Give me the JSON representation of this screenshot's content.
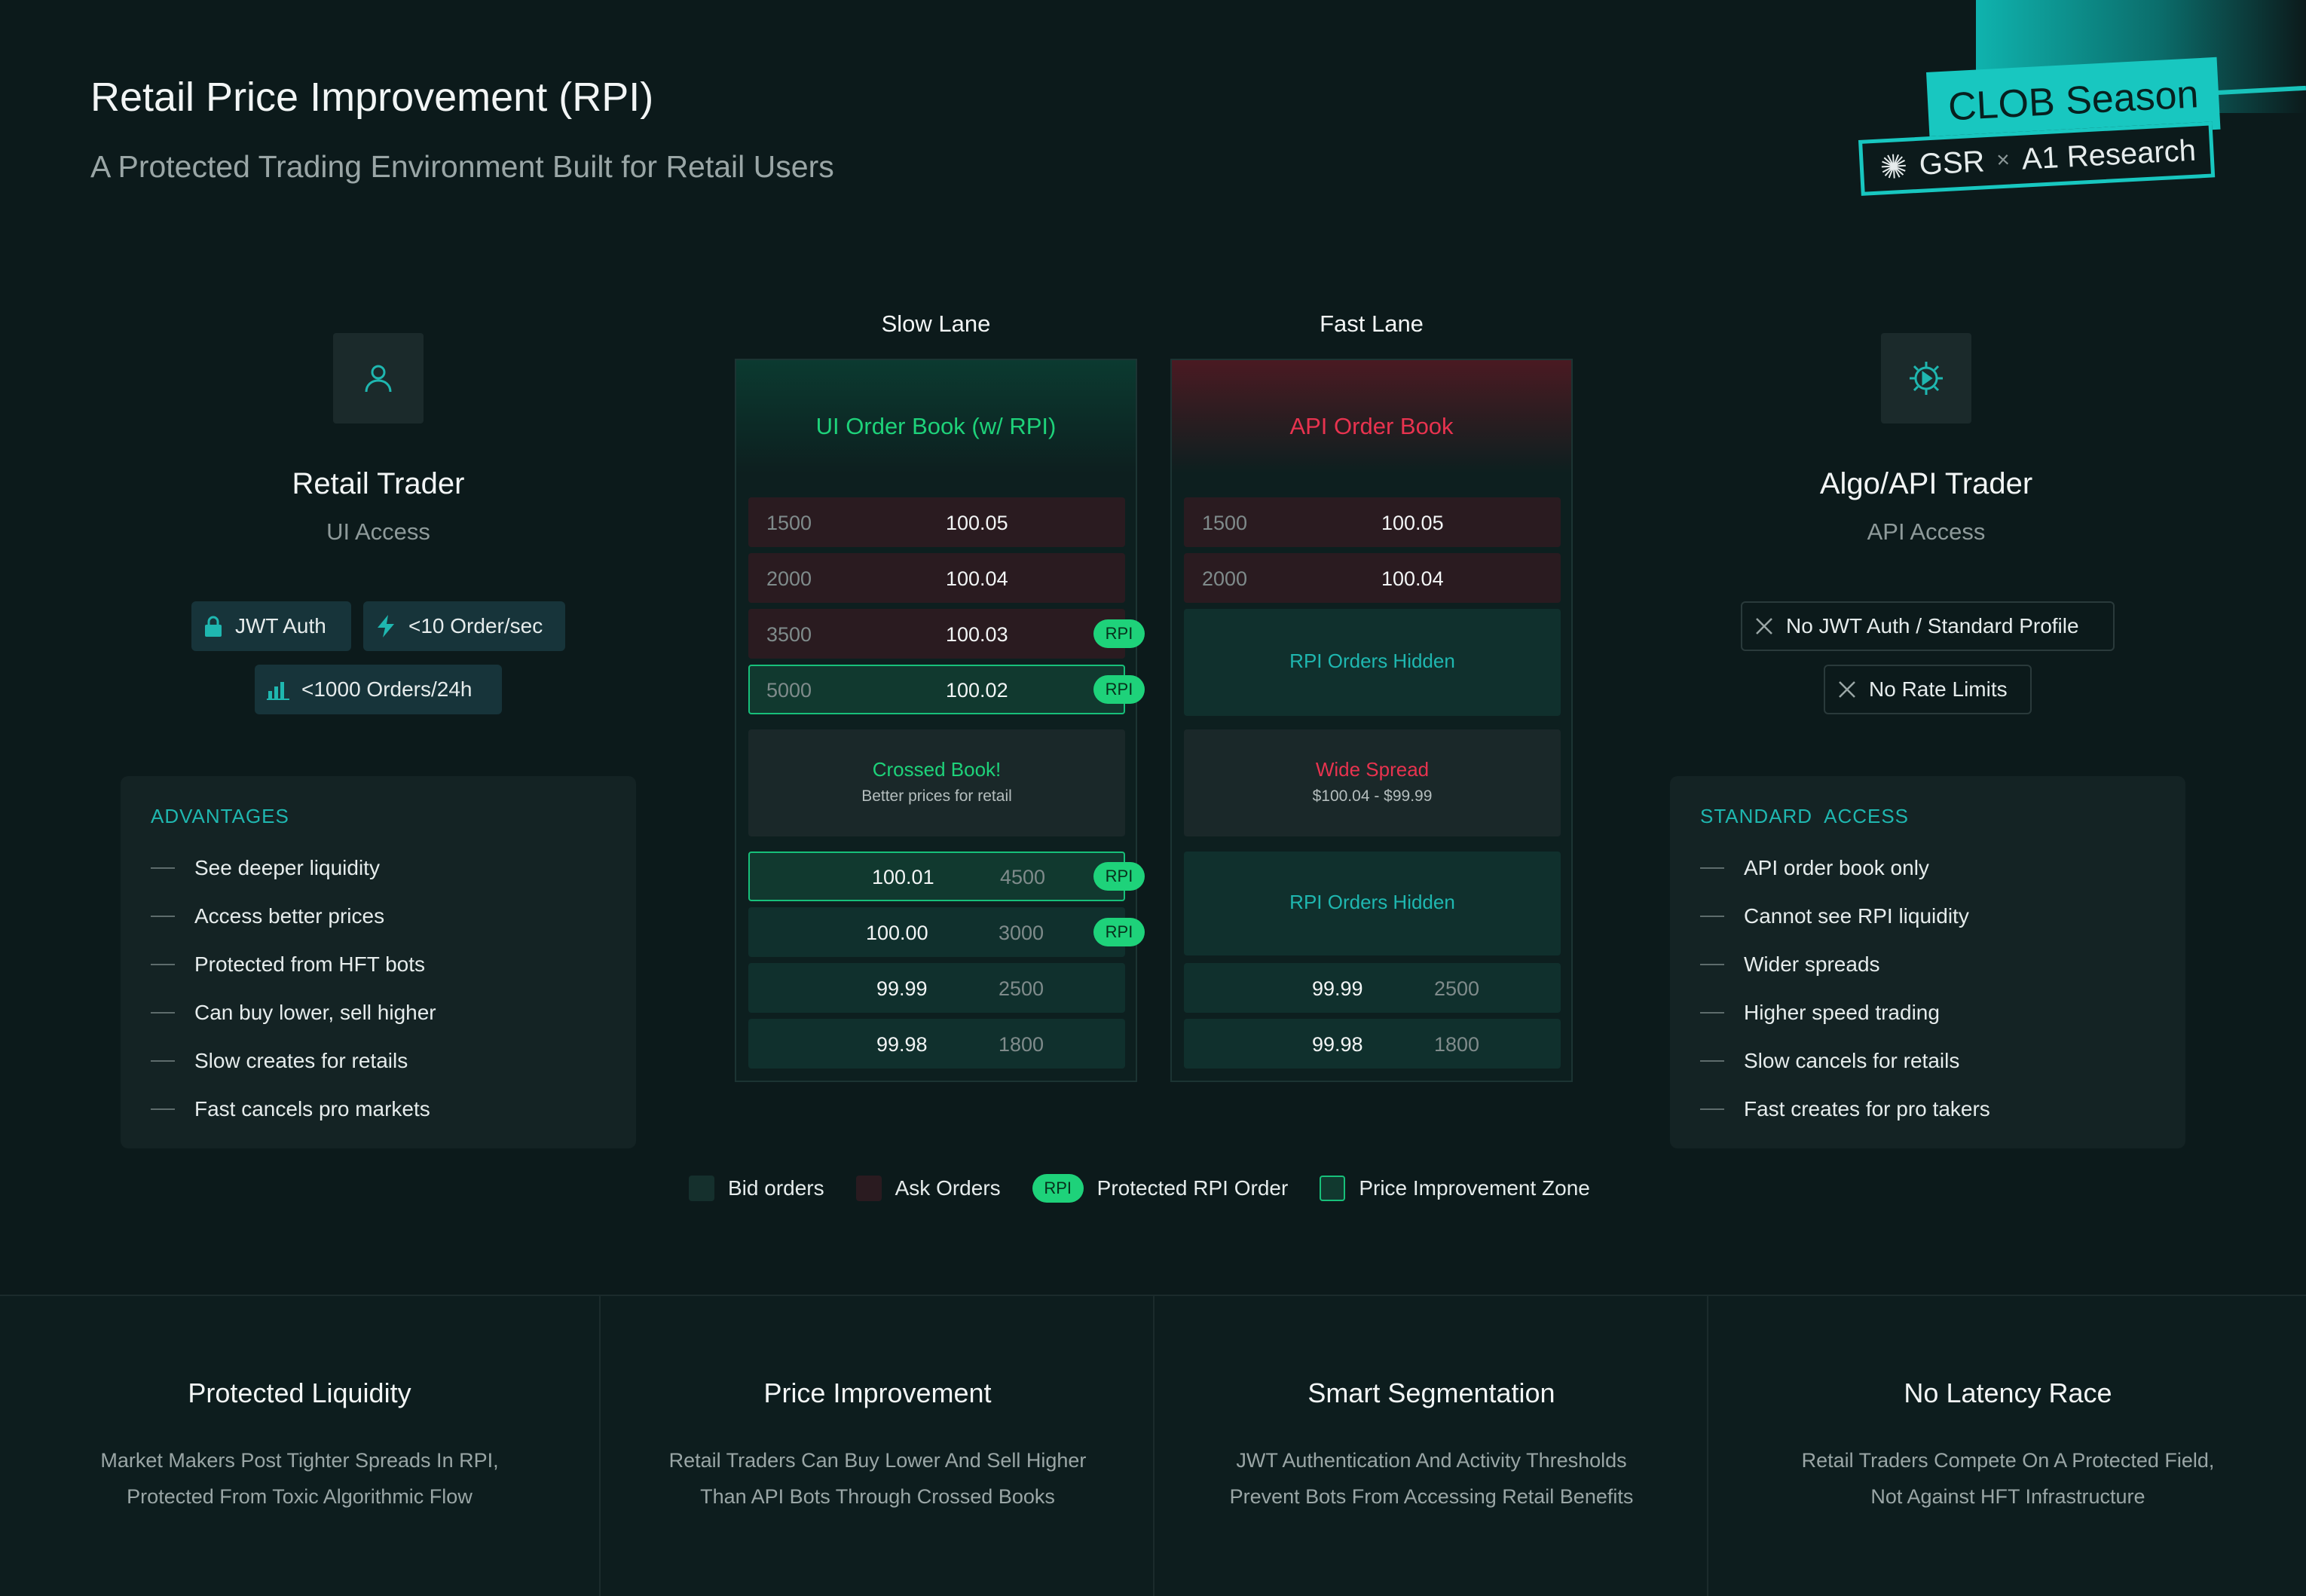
{
  "header": {
    "title": "Retail Price Improvement (RPI)",
    "subtitle": "A Protected Trading Environment Built for Retail Users"
  },
  "brand": {
    "season": "CLOB Season",
    "partner1": "GSR",
    "separator": "×",
    "partner2": "A1 Research",
    "accent": "#18c7c0"
  },
  "retail": {
    "icon": "user-icon",
    "title": "Retail Trader",
    "subtitle": "UI Access",
    "chips": [
      {
        "icon": "lock-icon",
        "label": "JWT Auth"
      },
      {
        "icon": "lightning-icon",
        "label": "<10 Order/sec"
      },
      {
        "icon": "bar-chart-icon",
        "label": "<1000 Orders/24h"
      }
    ],
    "panel_title": "ADVANTAGES",
    "items": [
      "See deeper liquidity",
      "Access better prices",
      "Protected from HFT bots",
      "Can buy lower, sell higher",
      "Slow creates for retails",
      "Fast cancels pro markets"
    ]
  },
  "algo": {
    "icon": "gear-icon",
    "title": "Algo/API Trader",
    "subtitle": "API Access",
    "chips": [
      {
        "icon": "close-icon",
        "label": "No JWT Auth / Standard Profile"
      },
      {
        "icon": "close-icon",
        "label": "No Rate Limits"
      }
    ],
    "panel_title": "STANDARD  ACCESS",
    "items": [
      "API order book only",
      "Cannot see RPI liquidity",
      "Wider spreads",
      "Higher speed trading",
      "Slow cancels for retails",
      "Fast creates for pro takers"
    ]
  },
  "slow": {
    "lane": "Slow Lane",
    "book_title": "UI Order Book (w/ RPI)",
    "asks": [
      {
        "qty": "1500",
        "price": "100.05",
        "rpi": ""
      },
      {
        "qty": "2000",
        "price": "100.04",
        "rpi": ""
      },
      {
        "qty": "3500",
        "price": "100.03",
        "rpi": "RPI"
      },
      {
        "qty": "5000",
        "price": "100.02",
        "rpi": "RPI"
      }
    ],
    "mid": {
      "title": "Crossed Book!",
      "sub": "Better prices for retail"
    },
    "bids": [
      {
        "price": "100.01",
        "qty": "4500",
        "rpi": "RPI"
      },
      {
        "price": "100.00",
        "qty": "3000",
        "rpi": "RPI"
      },
      {
        "price": "99.99",
        "qty": "2500",
        "rpi": ""
      },
      {
        "price": "99.98",
        "qty": "1800",
        "rpi": ""
      }
    ]
  },
  "fast": {
    "lane": "Fast Lane",
    "book_title": "API Order Book",
    "asks": [
      {
        "qty": "1500",
        "price": "100.05"
      },
      {
        "qty": "2000",
        "price": "100.04"
      }
    ],
    "hidden_top": "RPI Orders Hidden",
    "mid": {
      "title": "Wide Spread",
      "sub": "$100.04 - $99.99"
    },
    "hidden_bottom": "RPI Orders Hidden",
    "bids": [
      {
        "price": "99.99",
        "qty": "2500"
      },
      {
        "price": "99.98",
        "qty": "1800"
      }
    ]
  },
  "legend": {
    "bid": "Bid orders",
    "ask": "Ask Orders",
    "rpi_badge": "RPI",
    "rpi": "Protected RPI Order",
    "zone": "Price Improvement Zone"
  },
  "features": [
    {
      "title": "Protected Liquidity",
      "line1": "Market Makers Post Tighter Spreads In RPI,",
      "line2": "Protected From Toxic Algorithmic Flow"
    },
    {
      "title": "Price Improvement",
      "line1": "Retail Traders Can Buy Lower And Sell Higher",
      "line2": "Than API Bots Through Crossed Books"
    },
    {
      "title": "Smart Segmentation",
      "line1": "JWT Authentication And Activity Thresholds",
      "line2": "Prevent Bots From Accessing Retail Benefits"
    },
    {
      "title": "No Latency Race",
      "line1": "Retail Traders Compete On A Protected Field,",
      "line2": "Not Against HFT Infrastructure"
    }
  ],
  "colors": {
    "accent": "#1fb7b0",
    "green": "#1ed27a",
    "red": "#e8334f"
  }
}
